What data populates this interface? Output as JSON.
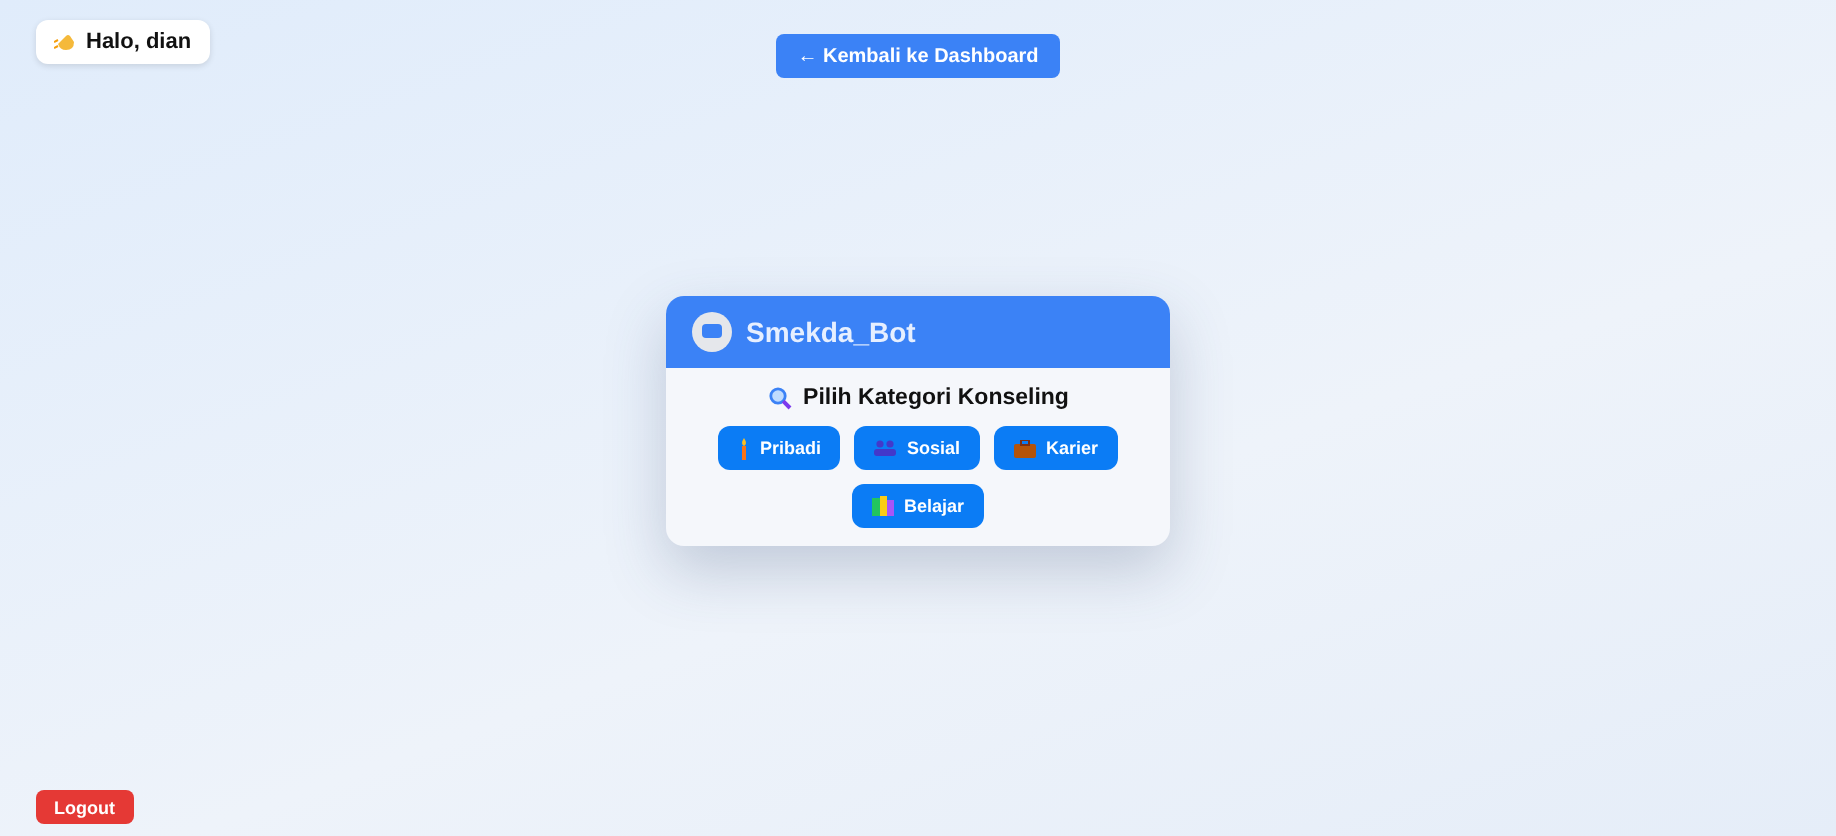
{
  "greeting": "Halo, dian",
  "back_button": "← Kembali ke Dashboard",
  "chat": {
    "title": "Smekda_Bot",
    "prompt": "Pilih Kategori Konseling",
    "categories": [
      {
        "label": "Pribadi",
        "kind": "person"
      },
      {
        "label": "Sosial",
        "kind": "people"
      },
      {
        "label": "Karier",
        "kind": "briefcase"
      },
      {
        "label": "Belajar",
        "kind": "books"
      }
    ]
  },
  "logout_button": "Logout"
}
